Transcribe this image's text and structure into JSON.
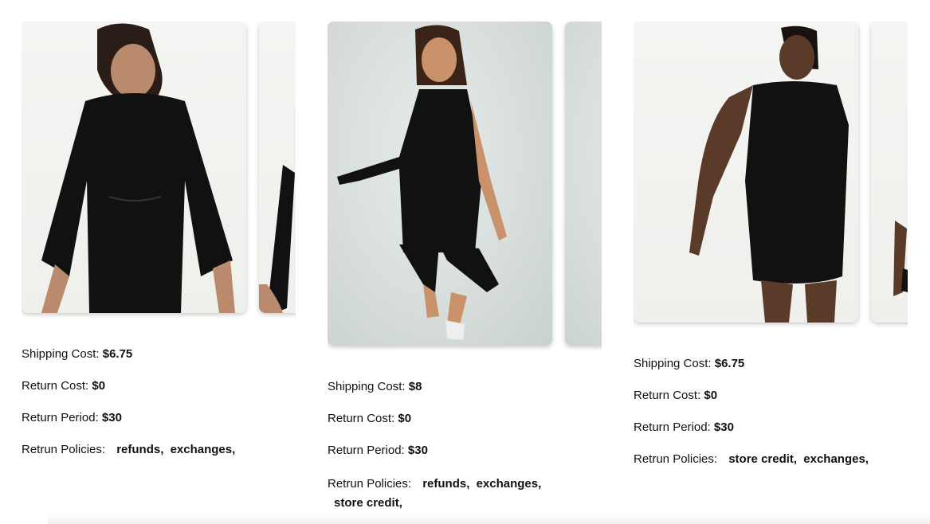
{
  "products": [
    {
      "shipping_label": "Shipping Cost:",
      "shipping_value": "$6.75",
      "return_cost_label": "Return Cost:",
      "return_cost_value": "$0",
      "return_period_label": "Return Period:",
      "return_period_value": "$30",
      "policies_label": "Retrun Policies:",
      "policies": [
        "refunds,",
        "exchanges,"
      ]
    },
    {
      "shipping_label": "Shipping Cost:",
      "shipping_value": "$8",
      "return_cost_label": "Return Cost:",
      "return_cost_value": "$0",
      "return_period_label": "Return Period:",
      "return_period_value": "$30",
      "policies_label": "Retrun Policies:",
      "policies": [
        "refunds,",
        "exchanges,",
        "store credit,"
      ]
    },
    {
      "shipping_label": "Shipping Cost:",
      "shipping_value": "$6.75",
      "return_cost_label": "Return Cost:",
      "return_cost_value": "$0",
      "return_period_label": "Return Period:",
      "return_period_value": "$30",
      "policies_label": "Retrun Policies:",
      "policies": [
        "store credit,",
        "exchanges,"
      ]
    }
  ]
}
